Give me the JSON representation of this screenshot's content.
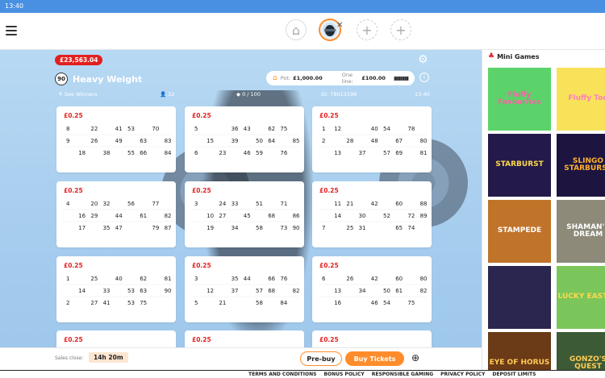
{
  "statusbar": {
    "time": "13:40"
  },
  "header": {
    "tabs": [
      {
        "name": "home",
        "icon": "home-icon"
      },
      {
        "name": "heavy-weight",
        "icon": "room-avatar-icon",
        "active": true
      },
      {
        "name": "add-1",
        "icon": "plus-icon"
      },
      {
        "name": "add-2",
        "icon": "plus-icon"
      }
    ]
  },
  "room": {
    "jackpot": "£23,563.04",
    "badge": "90",
    "name": "Heavy Weight",
    "pot_label": "Pot:",
    "pot_value": "£1,000.00",
    "oneline_label": "One line:",
    "oneline_value": "£100.00",
    "see_winners": "See Winners",
    "players": "32",
    "tickets_count": "0 / 100",
    "id": "ID: 78013198",
    "time": "13:40"
  },
  "tickets": [
    {
      "price": "£0.25",
      "rows": [
        [
          "8",
          "",
          "22",
          "",
          "41",
          "53",
          "",
          "70",
          ""
        ],
        [
          "9",
          "",
          "26",
          "",
          "49",
          "",
          "63",
          "",
          "83"
        ],
        [
          "",
          "18",
          "",
          "38",
          "",
          "55",
          "66",
          "",
          "84"
        ]
      ]
    },
    {
      "price": "£0.25",
      "rows": [
        [
          "5",
          "",
          "",
          "36",
          "43",
          "",
          "62",
          "75",
          ""
        ],
        [
          "",
          "15",
          "",
          "39",
          "",
          "50",
          "64",
          "",
          "85"
        ],
        [
          "6",
          "",
          "23",
          "",
          "46",
          "59",
          "",
          "76",
          ""
        ]
      ]
    },
    {
      "price": "£0.25",
      "rows": [
        [
          "1",
          "12",
          "",
          "",
          "40",
          "54",
          "",
          "78",
          ""
        ],
        [
          "2",
          "",
          "28",
          "",
          "48",
          "",
          "67",
          "",
          "80"
        ],
        [
          "",
          "13",
          "",
          "37",
          "",
          "57",
          "69",
          "",
          "81"
        ]
      ]
    },
    {
      "price": "£0.25",
      "rows": [
        [
          "4",
          "",
          "20",
          "32",
          "",
          "56",
          "",
          "77",
          ""
        ],
        [
          "",
          "16",
          "29",
          "",
          "44",
          "",
          "61",
          "",
          "82"
        ],
        [
          "",
          "17",
          "",
          "35",
          "47",
          "",
          "",
          "79",
          "87"
        ]
      ]
    },
    {
      "price": "£0.25",
      "rows": [
        [
          "3",
          "",
          "24",
          "33",
          "",
          "51",
          "",
          "71",
          ""
        ],
        [
          "",
          "10",
          "27",
          "",
          "45",
          "",
          "68",
          "",
          "86"
        ],
        [
          "",
          "19",
          "",
          "34",
          "",
          "58",
          "",
          "73",
          "90"
        ]
      ]
    },
    {
      "price": "£0.25",
      "rows": [
        [
          "",
          "11",
          "21",
          "",
          "42",
          "",
          "60",
          "",
          "88"
        ],
        [
          "",
          "14",
          "",
          "30",
          "",
          "52",
          "",
          "72",
          "89"
        ],
        [
          "7",
          "",
          "25",
          "31",
          "",
          "",
          "65",
          "74",
          ""
        ]
      ]
    },
    {
      "price": "£0.25",
      "rows": [
        [
          "1",
          "",
          "25",
          "",
          "40",
          "",
          "62",
          "",
          "81"
        ],
        [
          "",
          "14",
          "",
          "33",
          "",
          "53",
          "63",
          "",
          "90"
        ],
        [
          "2",
          "",
          "27",
          "41",
          "",
          "53",
          "75",
          "",
          ""
        ]
      ]
    },
    {
      "price": "£0.25",
      "rows": [
        [
          "3",
          "",
          "",
          "35",
          "44",
          "",
          "66",
          "76",
          ""
        ],
        [
          "",
          "12",
          "",
          "37",
          "",
          "57",
          "68",
          "",
          "82"
        ],
        [
          "5",
          "",
          "21",
          "",
          "",
          "58",
          "",
          "84",
          ""
        ]
      ]
    },
    {
      "price": "£0.25",
      "rows": [
        [
          "6",
          "",
          "26",
          "",
          "42",
          "",
          "60",
          "",
          "80"
        ],
        [
          "",
          "13",
          "",
          "34",
          "",
          "50",
          "61",
          "",
          "82"
        ],
        [
          "",
          "16",
          "",
          "",
          "46",
          "54",
          "",
          "75",
          ""
        ]
      ]
    },
    {
      "price": "£0.25",
      "rows": []
    },
    {
      "price": "£0.25",
      "rows": []
    },
    {
      "price": "£0.25",
      "rows": []
    }
  ],
  "bottom": {
    "sales_label": "Sales close:",
    "sales_time": "14h 20m",
    "prebuy": "Pre-buy",
    "buy": "Buy Tickets"
  },
  "sidebar": {
    "title": "Mini Games",
    "games": [
      {
        "label": "Fluffy Favourites",
        "bg": "#5bd36a",
        "fg": "#ff5fa8"
      },
      {
        "label": "Fluffy Too",
        "bg": "#f7e25a",
        "fg": "#ff7fc0"
      },
      {
        "label": "STARBURST",
        "bg": "#241a4a",
        "fg": "#ffd84a"
      },
      {
        "label": "SLINGO STARBURST",
        "bg": "#1d1540",
        "fg": "#ffb12b"
      },
      {
        "label": "STAMPEDE",
        "bg": "#c0742a",
        "fg": "#ffffff"
      },
      {
        "label": "SHAMAN'S DREAM",
        "bg": "#8d8a7a",
        "fg": "#ffffff"
      },
      {
        "label": "",
        "bg": "#2b2650",
        "fg": "#ffffff"
      },
      {
        "label": "LUCKY EASTER",
        "bg": "#7bc65b",
        "fg": "#ffd84a"
      },
      {
        "label": "EYE OF HORUS",
        "bg": "#6b3a16",
        "fg": "#ffcc55"
      },
      {
        "label": "GONZO'S QUEST",
        "bg": "#3c5a35",
        "fg": "#ffcc55"
      }
    ]
  },
  "footer": {
    "links": [
      "TERMS AND CONDITIONS",
      "BONUS POLICY",
      "RESPONSIBLE GAMING",
      "PRIVACY POLICY",
      "DEPOSIT LIMITS"
    ]
  },
  "colors": {
    "accent": "#ff8c2b",
    "price": "#e32020",
    "room_bg": "#a7cdee"
  }
}
